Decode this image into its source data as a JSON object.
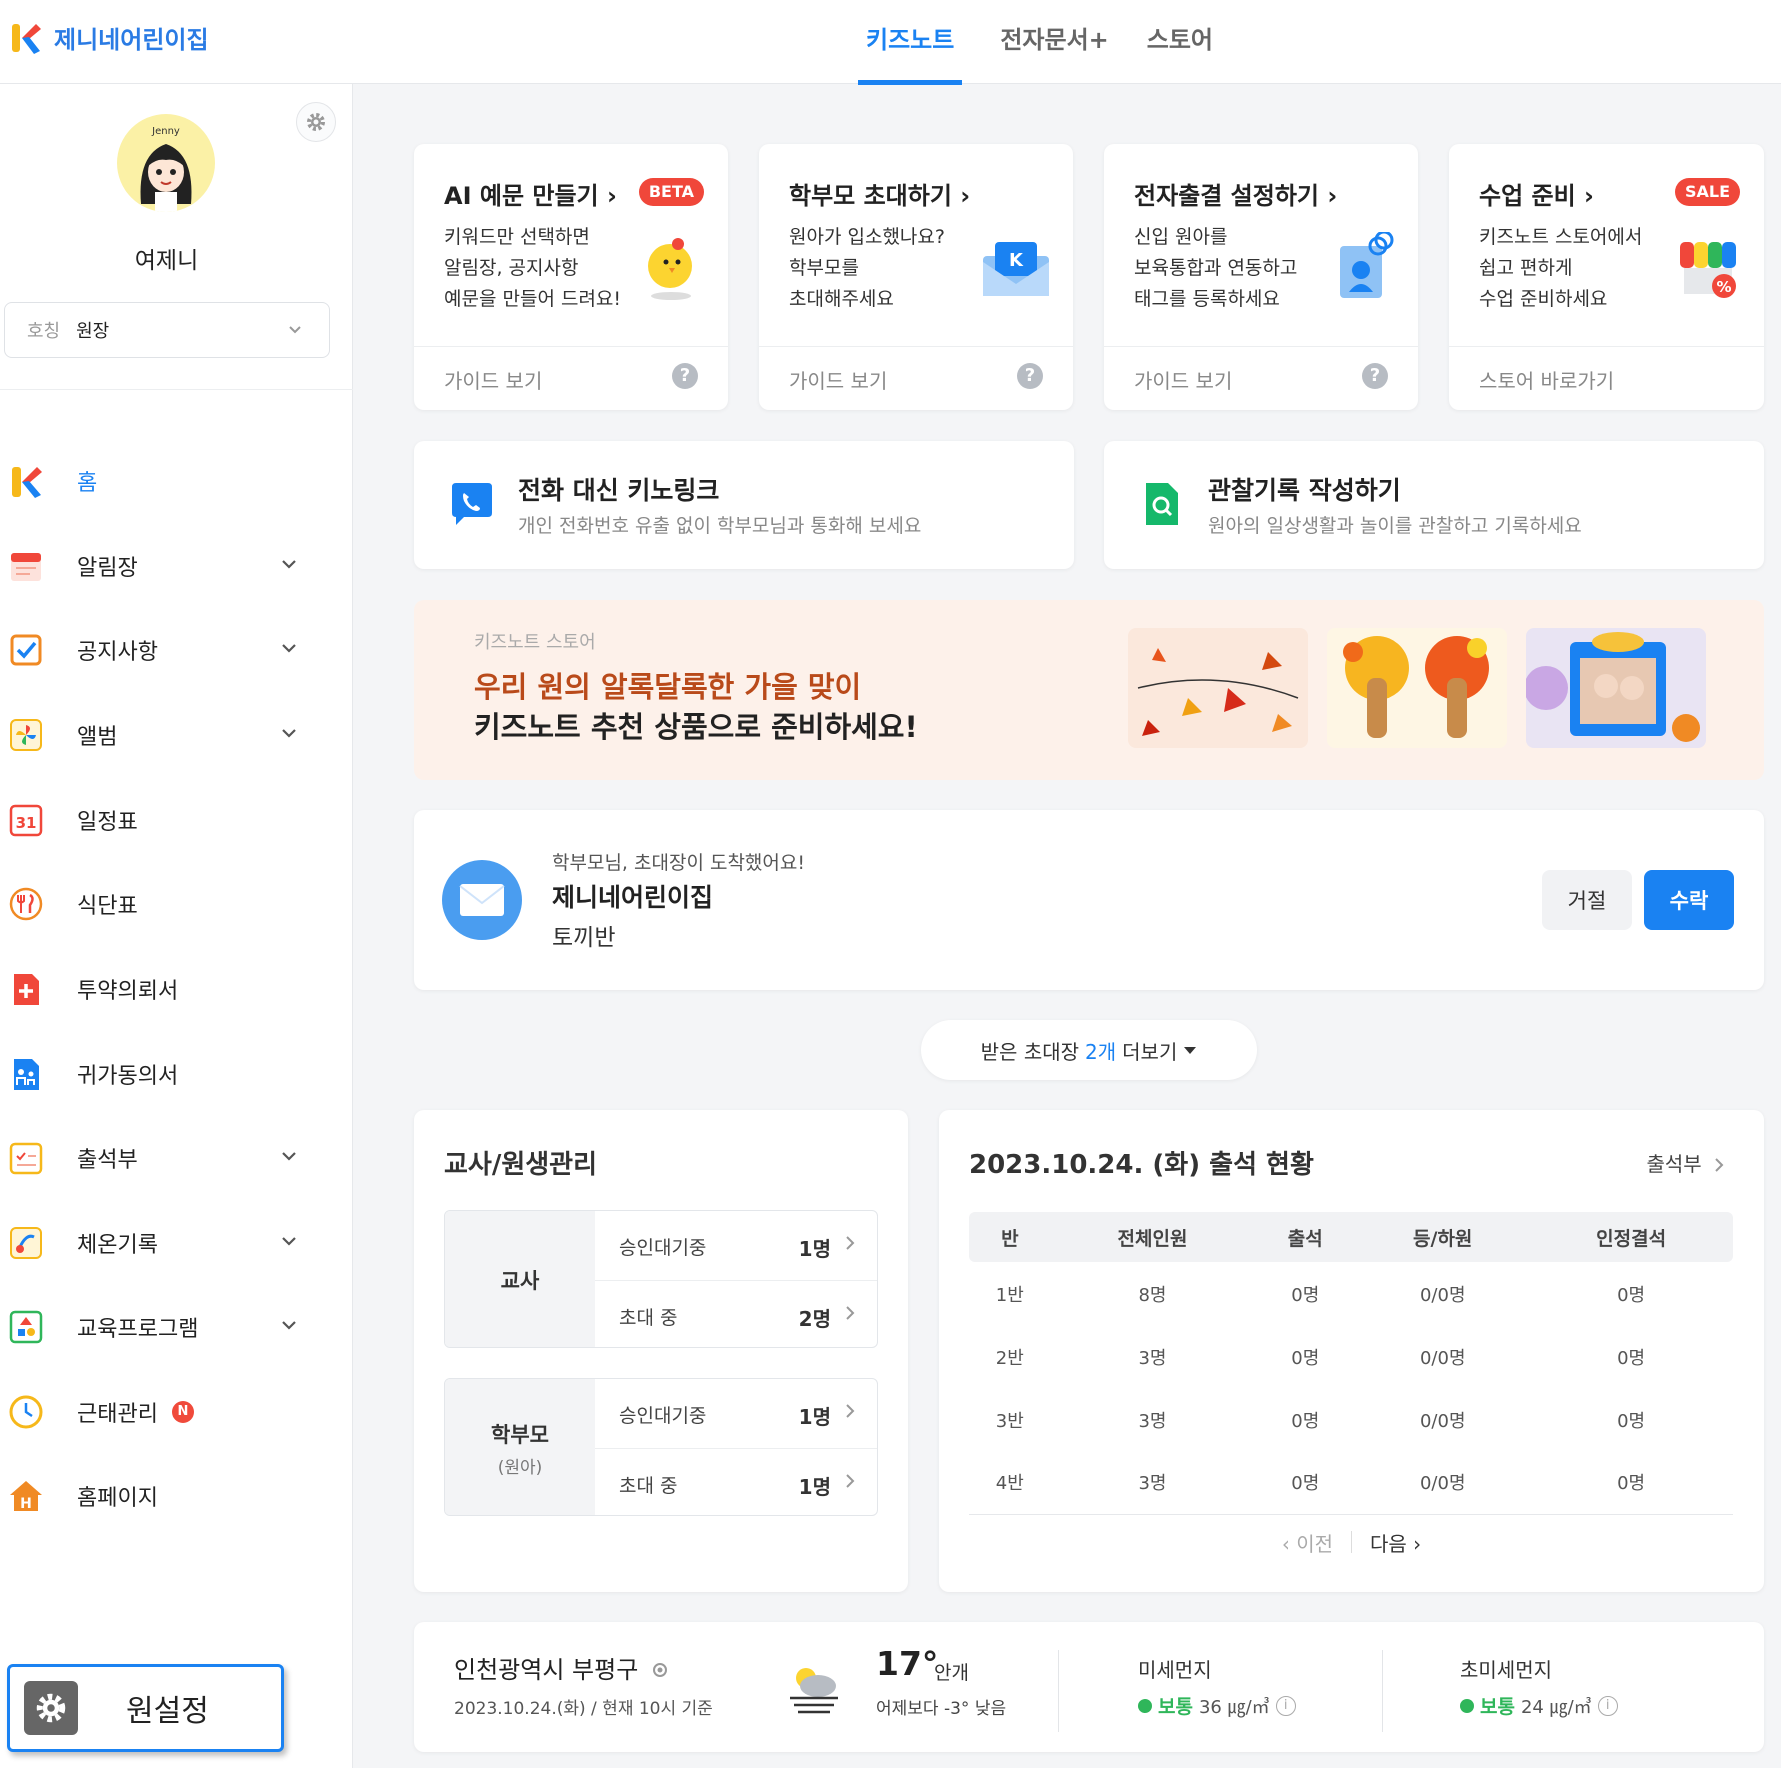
{
  "app": {
    "name": "제니네어린이집"
  },
  "topnav": {
    "tabs": [
      "키즈노트",
      "전자문서+",
      "스토어"
    ],
    "active": 0
  },
  "profile": {
    "avatar_text": "Jenny",
    "name": "여제니",
    "role_label": "호칭",
    "role_value": "원장"
  },
  "sidebar": {
    "items": [
      {
        "label": "홈",
        "icon": "kidsnote-logo-icon",
        "expandable": false,
        "active": true
      },
      {
        "label": "알림장",
        "icon": "notebook-icon",
        "expandable": true
      },
      {
        "label": "공지사항",
        "icon": "checkbox-notice-icon",
        "expandable": true
      },
      {
        "label": "앨범",
        "icon": "pinwheel-album-icon",
        "expandable": true
      },
      {
        "label": "일정표",
        "icon": "calendar-31-icon",
        "expandable": false
      },
      {
        "label": "식단표",
        "icon": "utensils-icon",
        "expandable": false
      },
      {
        "label": "투약의뢰서",
        "icon": "medicine-icon",
        "expandable": false
      },
      {
        "label": "귀가동의서",
        "icon": "family-doc-icon",
        "expandable": false
      },
      {
        "label": "출석부",
        "icon": "attendance-icon",
        "expandable": true
      },
      {
        "label": "체온기록",
        "icon": "thermometer-icon",
        "expandable": true
      },
      {
        "label": "교육프로그램",
        "icon": "education-icon",
        "expandable": true
      },
      {
        "label": "근태관리",
        "icon": "clock-icon",
        "expandable": false,
        "badge": "N"
      },
      {
        "label": "홈페이지",
        "icon": "home-h-icon",
        "expandable": false
      }
    ],
    "settings_label": "원설정"
  },
  "quick_cards": [
    {
      "title": "AI 예문 만들기",
      "badge": "BETA",
      "desc": [
        "키워드만 선택하면",
        "알림장, 공지사항",
        "예문을 만들어 드려요!"
      ],
      "footer": "가이드 보기",
      "help": "?"
    },
    {
      "title": "학부모 초대하기",
      "badge": "",
      "desc": [
        "원아가 입소했나요?",
        "학부모를",
        "초대해주세요"
      ],
      "footer": "가이드 보기",
      "help": "?"
    },
    {
      "title": "전자출결 설정하기",
      "badge": "",
      "desc": [
        "신입 원아를",
        "보육통합과 연동하고",
        "태그를 등록하세요"
      ],
      "footer": "가이드 보기",
      "help": "?"
    },
    {
      "title": "수업 준비",
      "badge": "SALE",
      "desc": [
        "키즈노트 스토어에서",
        "쉽고 편하게",
        "수업 준비하세요"
      ],
      "footer": "스토어 바로가기",
      "help": ""
    }
  ],
  "wide_cards": [
    {
      "title": "전화 대신 키노링크",
      "sub": "개인 전화번호 유출 없이 학부모님과 통화해 보세요"
    },
    {
      "title": "관찰기록 작성하기",
      "sub": "원아의 일상생활과 놀이를 관찰하고 기록하세요"
    }
  ],
  "banner": {
    "small": "키즈노트 스토어",
    "line1": "우리 원의 알록달록한 가을 맞이",
    "line2": "키즈노트 추천 상품으로 준비하세요!"
  },
  "invite": {
    "small": "학부모님, 초대장이 도착했어요!",
    "name": "제니네어린이집",
    "class": "토끼반",
    "reject": "거절",
    "accept": "수락"
  },
  "more": {
    "prefix": "받은 초대장",
    "count": "2개",
    "suffix": "더보기"
  },
  "management": {
    "title": "교사/원생관리",
    "groups": [
      {
        "title": "교사",
        "sub": "",
        "rows": [
          {
            "label": "승인대기중",
            "value": "1명"
          },
          {
            "label": "초대 중",
            "value": "2명"
          }
        ]
      },
      {
        "title": "학부모",
        "sub": "(원아)",
        "rows": [
          {
            "label": "승인대기중",
            "value": "1명"
          },
          {
            "label": "초대 중",
            "value": "1명"
          }
        ]
      }
    ]
  },
  "attendance": {
    "title": "2023.10.24. (화) 출석 현황",
    "link": "출석부",
    "columns": [
      "반",
      "전체인원",
      "출석",
      "등/하원",
      "인정결석"
    ],
    "rows": [
      [
        "1반",
        "8명",
        "0명",
        "0/0명",
        "0명"
      ],
      [
        "2반",
        "3명",
        "0명",
        "0/0명",
        "0명"
      ],
      [
        "3반",
        "3명",
        "0명",
        "0/0명",
        "0명"
      ],
      [
        "4반",
        "3명",
        "0명",
        "0/0명",
        "0명"
      ]
    ],
    "prev": "이전",
    "next": "다음"
  },
  "weather": {
    "location": "인천광역시 부평구",
    "date": "2023.10.24.(화) / 현재 10시 기준",
    "temp": "17°",
    "condition": "안개",
    "compare": "어제보다 -3° 낮음",
    "dust": [
      {
        "label": "미세먼지",
        "status": "보통",
        "value": "36 ㎍/㎥"
      },
      {
        "label": "초미세먼지",
        "status": "보통",
        "value": "24 ㎍/㎥"
      }
    ]
  },
  "colors": {
    "accent": "#1a82f2",
    "brand": "#2a7be4",
    "badge_red": "#f0473a",
    "good": "#2fb65a"
  }
}
